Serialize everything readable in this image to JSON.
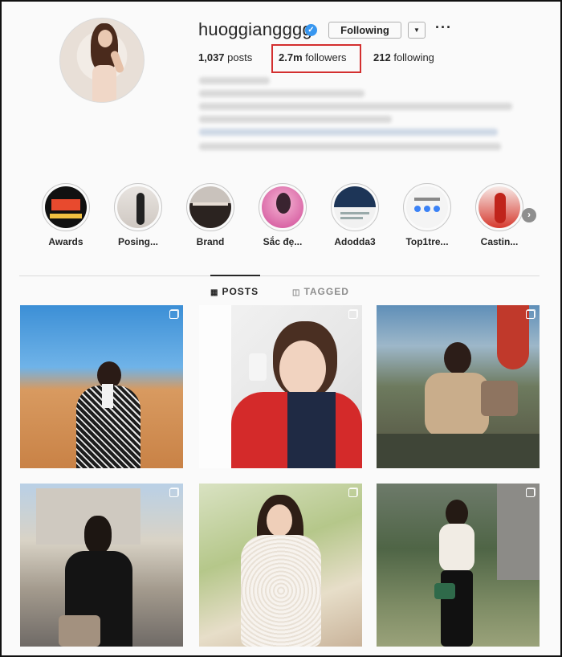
{
  "profile": {
    "username": "huoggiangggg",
    "verified_icon": "verified-badge-icon",
    "following_button": "Following",
    "dropdown_icon": "chevron-down-icon",
    "more_icon": "more-options-icon",
    "more_glyph": "···",
    "stats": {
      "posts_count": "1,037",
      "posts_label": "posts",
      "followers_count": "2.7m",
      "followers_label": "followers",
      "following_count": "212",
      "following_label": "following"
    },
    "highlight_color": "#d32f2f"
  },
  "stories": [
    {
      "label": "Awards"
    },
    {
      "label": "Posing..."
    },
    {
      "label": "Brand"
    },
    {
      "label": "Sắc đẹ..."
    },
    {
      "label": "Adodda3"
    },
    {
      "label": "Top1tre..."
    },
    {
      "label": "Castin..."
    }
  ],
  "stories_next_glyph": "›",
  "tabs": {
    "posts": "POSTS",
    "posts_icon": "grid-icon",
    "tagged": "TAGGED",
    "tagged_icon": "tag-icon"
  },
  "colors": {
    "verified": "#3897f0",
    "text": "#262626",
    "muted": "#8e8e8e",
    "border": "#dbdbdb"
  }
}
